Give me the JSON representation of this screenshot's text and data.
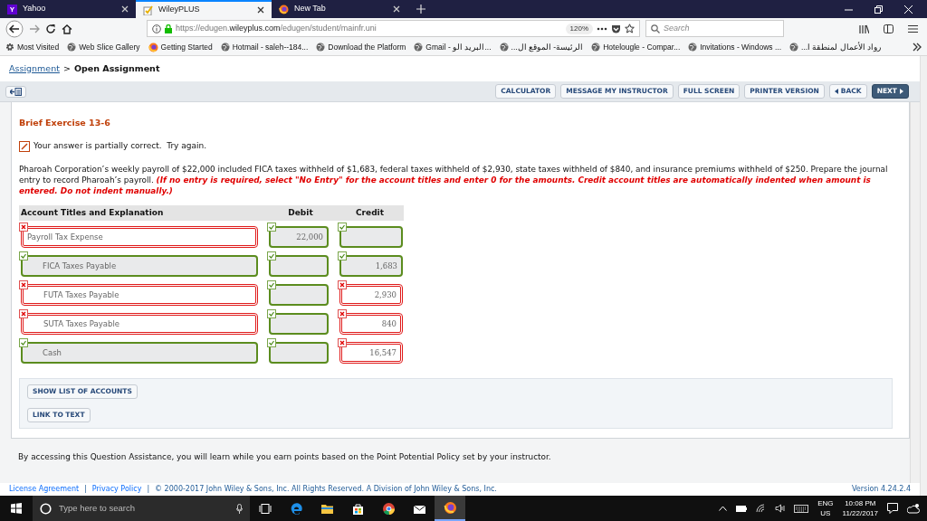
{
  "browser": {
    "tabs": [
      {
        "title": "Yahoo",
        "icon_letter": "Y",
        "kind": "yahoo",
        "selected": false
      },
      {
        "title": "WileyPLUS",
        "kind": "wiley",
        "selected": true
      },
      {
        "title": "New Tab",
        "kind": "firefox",
        "selected": false
      }
    ],
    "url": {
      "prefix": "https://edugen.",
      "host": "wileyplus.com",
      "path": "/edugen/student/mainfr.uni"
    },
    "zoom": "120%",
    "search": {
      "placeholder": "Search"
    },
    "bookmarks": [
      {
        "label": "Most Visited",
        "kind": "smart-folder"
      },
      {
        "label": "Web Slice Gallery",
        "kind": "site"
      },
      {
        "label": "Getting Started",
        "kind": "firefox-page"
      },
      {
        "label": "Hotmail - saleh--184...",
        "kind": "site"
      },
      {
        "label": "Download the Platform",
        "kind": "site"
      },
      {
        "label": "Gmail - البريد الو...",
        "kind": "site"
      },
      {
        "label": "الرئيسة- الموقع ال...",
        "kind": "site"
      },
      {
        "label": "Hotelougle - Compar...",
        "kind": "site"
      },
      {
        "label": "Invitations - Windows ...",
        "kind": "site"
      },
      {
        "label": "رواد الأعمال لمنطقة ا...",
        "kind": "site"
      }
    ]
  },
  "page": {
    "breadcrumb": {
      "link": "Assignment",
      "separator": ">",
      "current": "Open Assignment"
    },
    "toolbar": [
      {
        "label": "CALCULATOR",
        "kind": "plain"
      },
      {
        "label": "MESSAGE MY INSTRUCTOR",
        "kind": "plain"
      },
      {
        "label": "FULL SCREEN",
        "kind": "plain"
      },
      {
        "label": "PRINTER VERSION",
        "kind": "plain"
      },
      {
        "label": "BACK",
        "kind": "back"
      },
      {
        "label": "NEXT",
        "kind": "next"
      }
    ],
    "exercise_title": "Brief Exercise 13-6",
    "feedback": "Your answer is partially correct.  Try again.",
    "problem": "Pharoah Corporation’s weekly payroll of $22,000 included FICA taxes withheld of $1,683, federal taxes withheld of $2,930, state taxes withheld of $840, and insurance premiums withheld of $250. Prepare the journal entry to record Pharoah’s payroll.",
    "instruction": "(If no entry is required, select \"No Entry\" for the account titles and enter 0 for the amounts. Credit account titles are automatically indented when amount is entered. Do not indent manually.)",
    "table": {
      "columns": [
        "Account Titles and Explanation",
        "Debit",
        "Credit"
      ],
      "rows": [
        {
          "account": "Payroll Tax Expense",
          "indented": false,
          "debit": "22,000",
          "account_correct": false,
          "debit_correct": true,
          "credit_correct": true
        },
        {
          "account": "FICA Taxes Payable",
          "indented": true,
          "credit": "1,683",
          "account_correct": true,
          "debit_correct": true,
          "credit_correct": true
        },
        {
          "account": "FUTA Taxes Payable",
          "indented": true,
          "credit": "2,930",
          "account_correct": false,
          "debit_correct": true,
          "credit_correct": false
        },
        {
          "account": "SUTA Taxes Payable",
          "indented": true,
          "credit": "840",
          "account_correct": false,
          "debit_correct": true,
          "credit_correct": false
        },
        {
          "account": "Cash",
          "indented": true,
          "credit": "16,547",
          "account_correct": true,
          "debit_correct": true,
          "credit_correct": false
        }
      ]
    },
    "assist_buttons": [
      "SHOW LIST OF ACCOUNTS",
      "LINK TO TEXT"
    ],
    "note": "By accessing this Question Assistance, you will learn while you earn points based on the Point Potential Policy set by your instructor.",
    "footer": {
      "links": [
        "License Agreement",
        "Privacy Policy"
      ],
      "separator": "|",
      "copyright": "© 2000-2017 John Wiley & Sons, Inc. All Rights Reserved. A Division of John Wiley & Sons, Inc.",
      "version": "Version 4.24.2.4"
    }
  },
  "taskbar": {
    "search_placeholder": "Type here to search",
    "apps": [
      {
        "kind": "edge",
        "selected": false
      },
      {
        "kind": "folder",
        "selected": false
      },
      {
        "kind": "store",
        "selected": false
      },
      {
        "kind": "chrome",
        "selected": false
      },
      {
        "kind": "mail",
        "selected": false
      },
      {
        "kind": "firefox",
        "selected": true
      }
    ],
    "language": "ENG",
    "region": "US",
    "time": "10:08 PM",
    "date": "11/22/2017"
  }
}
